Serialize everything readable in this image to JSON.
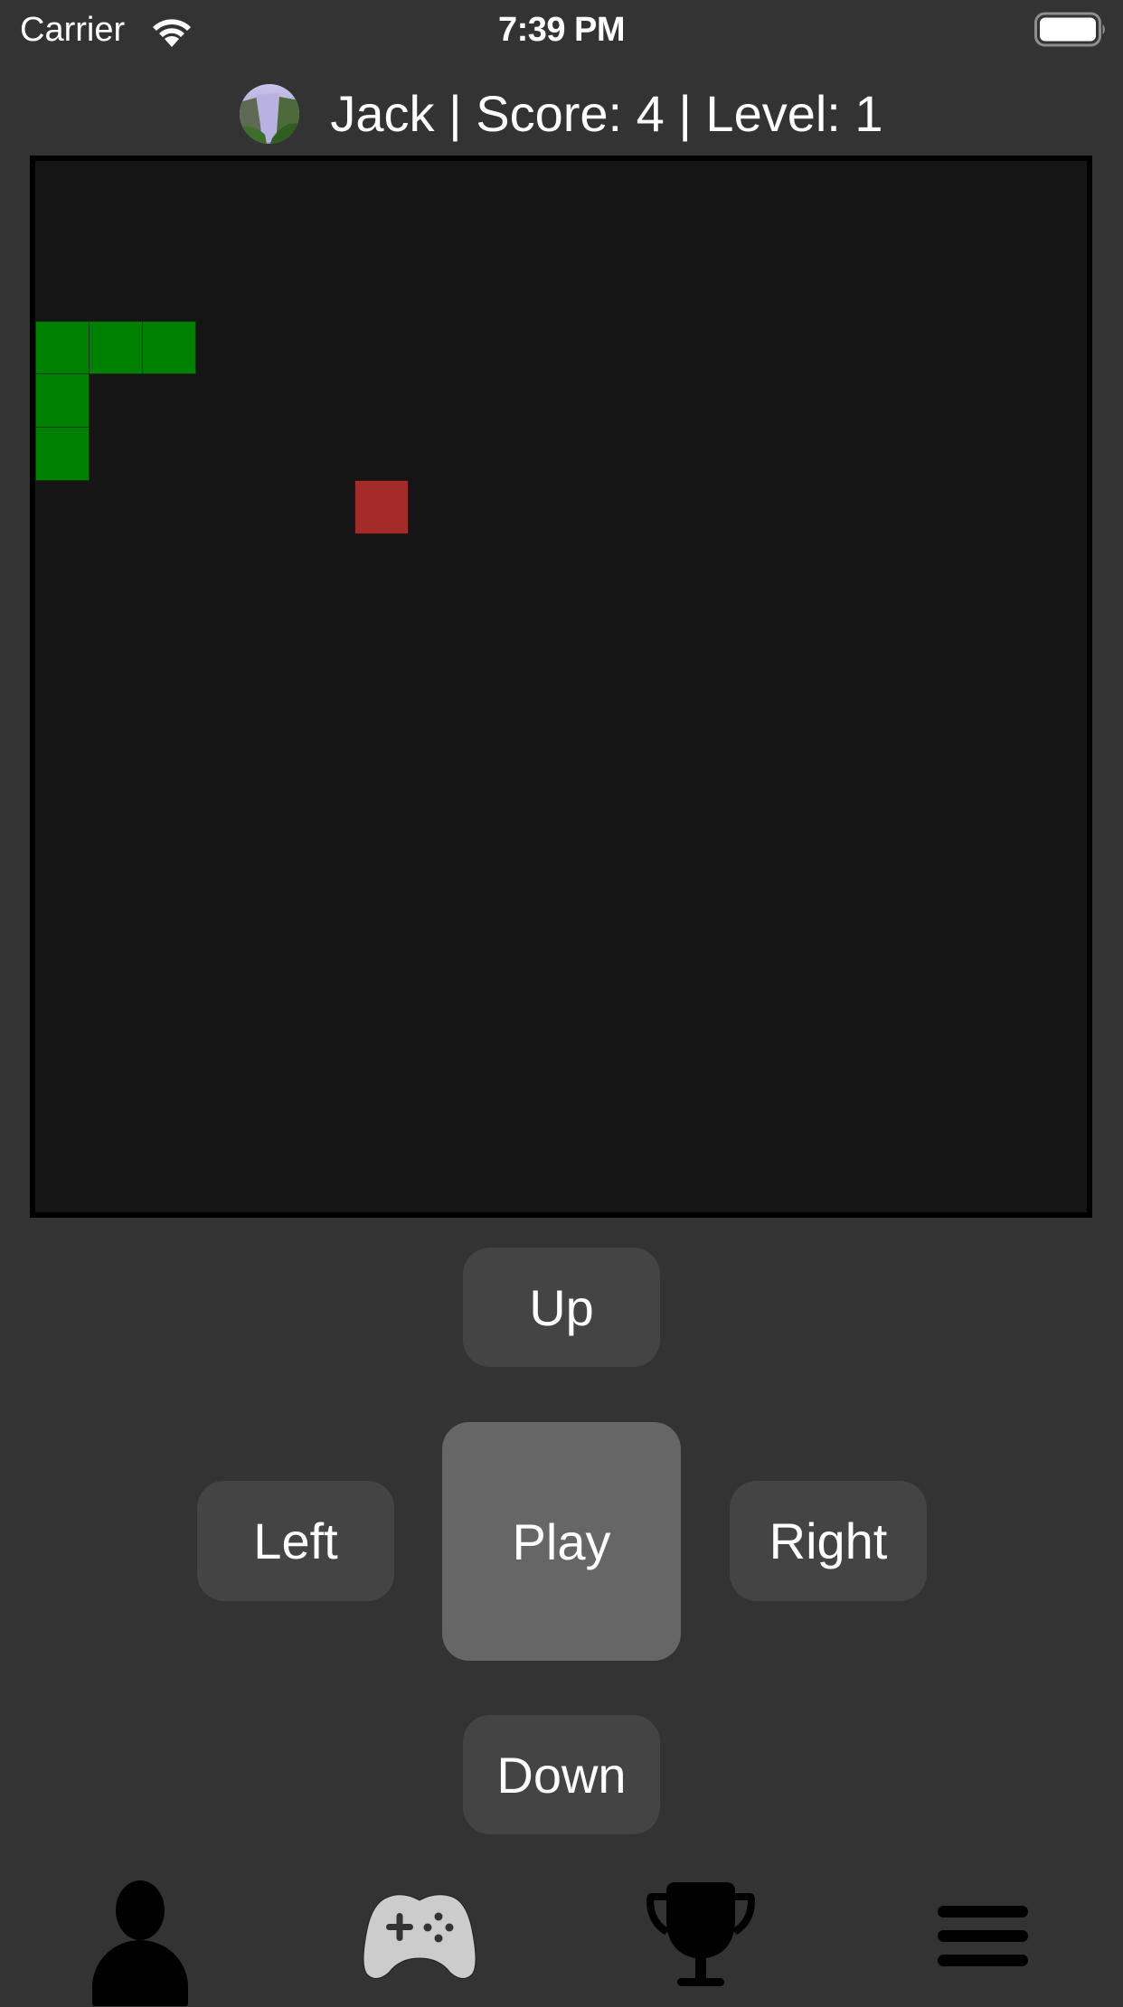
{
  "status_bar": {
    "carrier": "Carrier",
    "time": "7:39 PM",
    "wifi_icon": "wifi-icon",
    "battery_icon": "battery-full-icon",
    "battery_level": 1.0
  },
  "header": {
    "avatar": "waterfall-avatar",
    "player_name": "Jack",
    "score": 4,
    "level": 1,
    "title": "Jack | Score: 4 | Level: 1"
  },
  "board": {
    "grid_columns": 20,
    "grid_rows": 20,
    "colors": {
      "background": "#151515",
      "border": "#000000",
      "snake": "#008000",
      "food": "#a52a2a"
    },
    "snake": [
      {
        "col": 2,
        "row": 3
      },
      {
        "col": 1,
        "row": 3
      },
      {
        "col": 0,
        "row": 3
      },
      {
        "col": 0,
        "row": 4
      },
      {
        "col": 0,
        "row": 5
      }
    ],
    "food": {
      "col": 6,
      "row": 6
    }
  },
  "controls": {
    "up_label": "Up",
    "left_label": "Left",
    "play_label": "Play",
    "right_label": "Right",
    "down_label": "Down",
    "colors": {
      "button": "#444444",
      "play_button": "#666666"
    }
  },
  "tab_bar": {
    "tabs": [
      {
        "name": "profile",
        "icon": "person-icon",
        "selected": false
      },
      {
        "name": "game",
        "icon": "gamecontroller-icon",
        "selected": true
      },
      {
        "name": "leaderboard",
        "icon": "trophy-icon",
        "selected": false
      },
      {
        "name": "menu",
        "icon": "hamburger-menu-icon",
        "selected": false
      }
    ],
    "colors": {
      "selected": "#cccccc",
      "unselected": "#000000"
    }
  }
}
